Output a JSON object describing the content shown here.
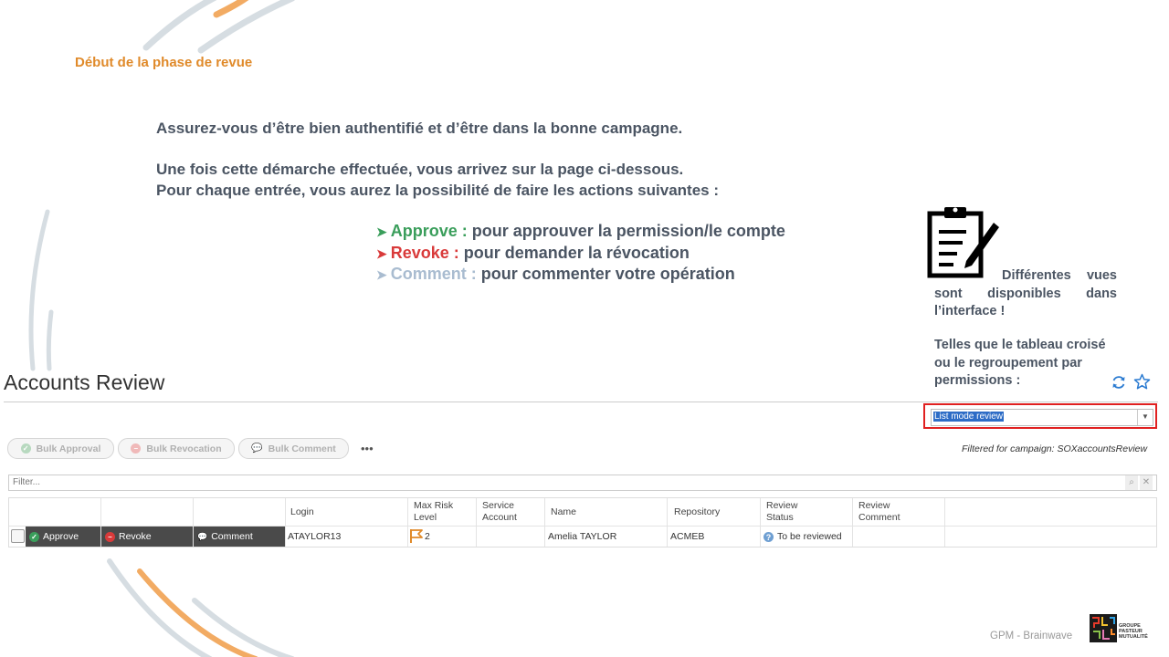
{
  "slide": {
    "title": "Début de la phase de revue",
    "intro_1": "Assurez-vous d’être bien authentifié et d’être dans la bonne campagne.",
    "intro_2": "Une fois cette démarche effectuée, vous arrivez sur la page ci-dessous.",
    "intro_3": "Pour chaque entrée, vous aurez la possibilité de faire les actions suivantes :",
    "bullets": [
      {
        "keyword": "Approve :",
        "text": "pour approuver la permission/le compte",
        "color": "#3a9e5b"
      },
      {
        "keyword": "Revoke :",
        "text": "pour demander la révocation",
        "color": "#d93a3a"
      },
      {
        "keyword": "Comment :",
        "text": "pour commenter votre opération",
        "color": "#a9bcd0"
      }
    ],
    "note_1": "Différentes vues sont disponibles dans l’interface !",
    "note_2": "Telles que le tableau croisé ou le regroupement par permissions :",
    "footer": "GPM - Brainwave",
    "logo_text": "GROUPE PASTEUR MUTUALITÉ"
  },
  "app": {
    "title": "Accounts Review",
    "view_select": "List mode review",
    "toolbar": {
      "bulk_approval": "Bulk Approval",
      "bulk_revocation": "Bulk Revocation",
      "bulk_comment": "Bulk Comment",
      "more": "•••"
    },
    "filtered_for": "Filtered for campaign: SOXaccountsReview",
    "filter_placeholder": "Filter...",
    "columns": {
      "login": "Login",
      "max_risk_1": "Max Risk",
      "max_risk_2": "Level",
      "service_1": "Service",
      "service_2": "Account",
      "name": "Name",
      "repository": "Repository",
      "review_status_1": "Review",
      "review_status_2": "Status",
      "review_comment_1": "Review",
      "review_comment_2": "Comment"
    },
    "row": {
      "approve": "Approve",
      "revoke": "Revoke",
      "comment": "Comment",
      "login": "ATAYLOR13",
      "risk": "2",
      "service_account": "",
      "name": "Amelia TAYLOR",
      "repository": "ACMEB",
      "status": "To be reviewed",
      "review_comment": ""
    }
  },
  "colors": {
    "accent_orange": "#e08a2a",
    "approve": "#3a9e5b",
    "revoke": "#d93a3a",
    "selection": "#2d6cc6",
    "highlight_frame": "#e02020"
  }
}
